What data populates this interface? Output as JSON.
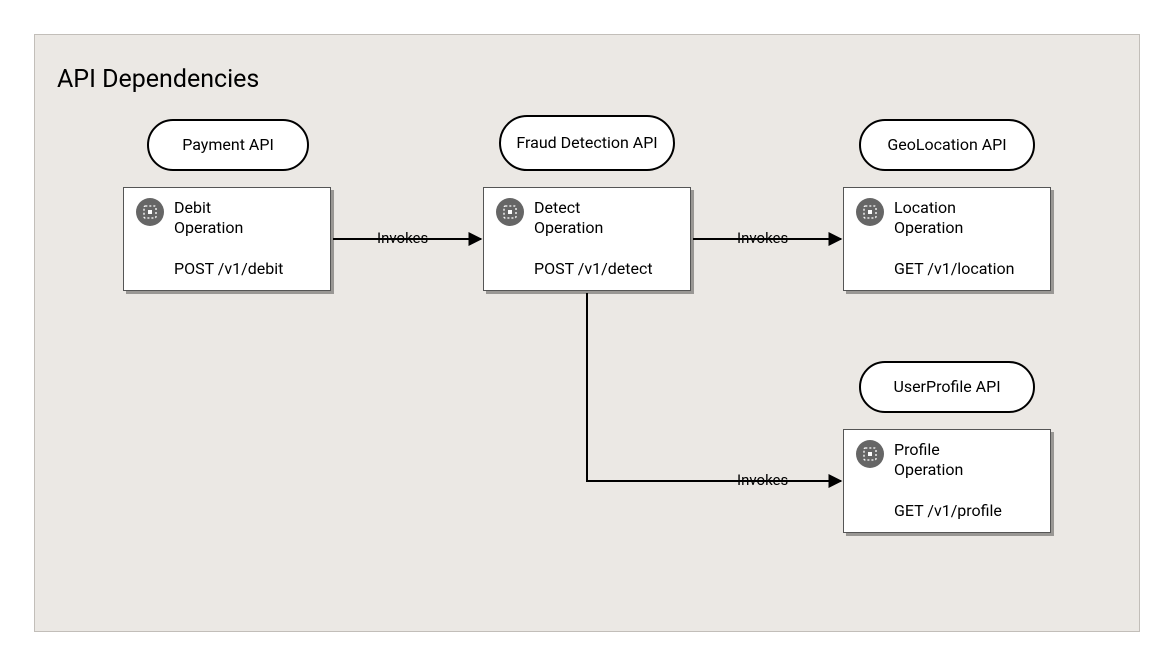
{
  "title": "API Dependencies",
  "apis": {
    "payment": {
      "label": "Payment API"
    },
    "fraud": {
      "label": "Fraud Detection API"
    },
    "geo": {
      "label": "GeoLocation API"
    },
    "profile": {
      "label": "UserProfile API"
    }
  },
  "operations": {
    "debit": {
      "title": "Debit Operation",
      "endpoint": "POST /v1/debit"
    },
    "detect": {
      "title": "Detect Operation",
      "endpoint": "POST /v1/detect"
    },
    "location": {
      "title": "Location Operation",
      "endpoint": "GET /v1/location"
    },
    "profile": {
      "title": "Profile Operation",
      "endpoint": "GET /v1/profile"
    }
  },
  "edges": {
    "debit_to_detect": {
      "label": "Invokes"
    },
    "detect_to_location": {
      "label": "Invokes"
    },
    "detect_to_profile": {
      "label": "Invokes"
    }
  }
}
